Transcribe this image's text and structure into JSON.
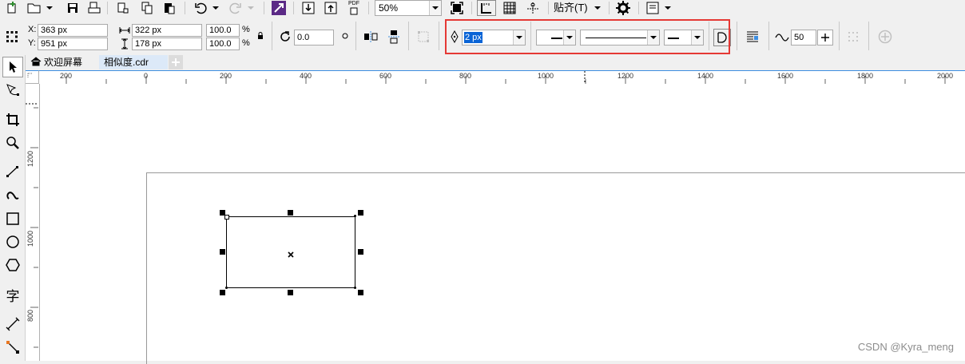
{
  "toolbar": {
    "zoom_value": "50%",
    "snap_label": "贴齐(T)",
    "pdf_label": "PDF"
  },
  "property_bar": {
    "x_label": "X:",
    "x_value": "363 px",
    "y_label": "Y:",
    "y_value": "951 px",
    "width_value": "322 px",
    "height_value": "178 px",
    "scale_x_value": "100.0",
    "scale_y_value": "100.0",
    "percent_symbol": "%",
    "rotation_value": "0.0",
    "outline_width_value": "2 px",
    "smoothing_value": "50"
  },
  "tabs": [
    {
      "label": "欢迎屏幕",
      "active": false
    },
    {
      "label": "相似度.cdr",
      "active": true
    }
  ],
  "ruler": {
    "h_labels": [
      "200",
      "0",
      "200",
      "400",
      "600",
      "800",
      "1000",
      "1200",
      "1400",
      "1600",
      "1800",
      "2000"
    ],
    "v_labels": [
      "1200",
      "1000",
      "800"
    ]
  },
  "toolbox": {
    "text_tool_label": "字"
  },
  "watermark": "CSDN @Kyra_meng",
  "colors": {
    "highlight_box": "#e53935",
    "selection_blue": "#0a64d6",
    "tab_active_bg": "#dce9f8",
    "ruler_accent": "#3d8ee0"
  }
}
